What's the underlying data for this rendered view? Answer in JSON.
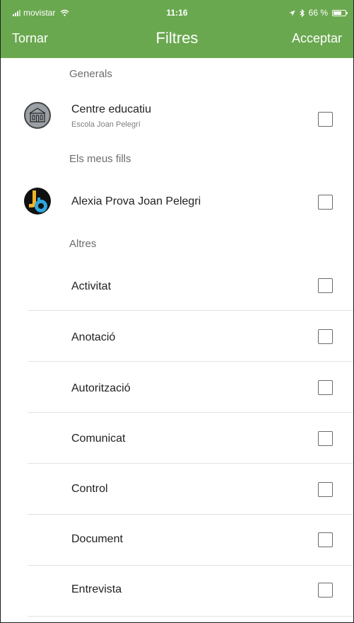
{
  "status": {
    "carrier": "movistar",
    "time": "11:16",
    "battery": "66 %"
  },
  "nav": {
    "back": "Tornar",
    "title": "Filtres",
    "accept": "Acceptar"
  },
  "sections": {
    "general": "Generals",
    "children": "Els meus fills",
    "others": "Altres"
  },
  "general_item": {
    "title": "Centre educatiu",
    "subtitle": "Escola Joan Pelegrí"
  },
  "child_item": {
    "name": "Alexia Prova Joan Pelegri"
  },
  "other_items": [
    {
      "label": "Activitat"
    },
    {
      "label": "Anotació"
    },
    {
      "label": "Autorització"
    },
    {
      "label": "Comunicat"
    },
    {
      "label": "Control"
    },
    {
      "label": "Document"
    },
    {
      "label": "Entrevista"
    }
  ],
  "colors": {
    "header": "#6aa84f",
    "section_text": "#6d6d6d",
    "checkbox_border": "#6a6a6a"
  },
  "icons": {
    "signal": "signal-bars-icon",
    "wifi": "wifi-icon",
    "location": "location-arrow-icon",
    "bluetooth": "bluetooth-icon",
    "battery": "battery-icon",
    "school": "school-building-icon",
    "child": "child-avatar-icon"
  }
}
